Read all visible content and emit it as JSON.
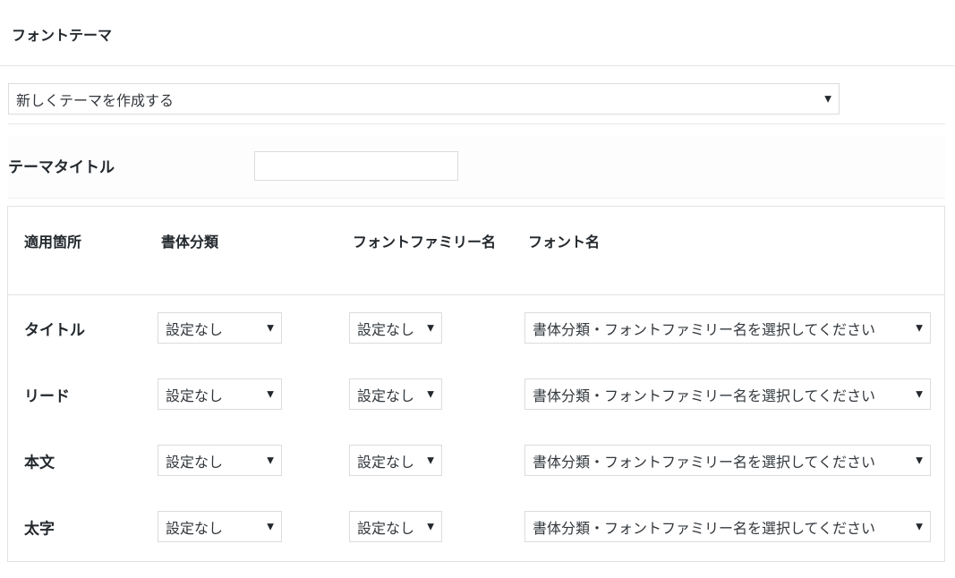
{
  "header": {
    "title": "フォントテーマ"
  },
  "theme_select": {
    "value": "新しくテーマを作成する"
  },
  "theme_title": {
    "label": "テーマタイトル",
    "value": ""
  },
  "table": {
    "headers": {
      "location": "適用箇所",
      "category": "書体分類",
      "family": "フォントファミリー名",
      "font_name": "フォント名"
    },
    "rows": [
      {
        "label": "タイトル",
        "category": "設定なし",
        "family": "設定なし",
        "font_name": "書体分類・フォントファミリー名を選択してください"
      },
      {
        "label": "リード",
        "category": "設定なし",
        "family": "設定なし",
        "font_name": "書体分類・フォントファミリー名を選択してください"
      },
      {
        "label": "本文",
        "category": "設定なし",
        "family": "設定なし",
        "font_name": "書体分類・フォントファミリー名を選択してください"
      },
      {
        "label": "太字",
        "category": "設定なし",
        "family": "設定なし",
        "font_name": "書体分類・フォントファミリー名を選択してください"
      }
    ]
  },
  "icons": {
    "dropdown": "caret-down-icon"
  },
  "colors": {
    "text": "#23282d",
    "border": "#dcdcdc",
    "background": "#ffffff"
  }
}
